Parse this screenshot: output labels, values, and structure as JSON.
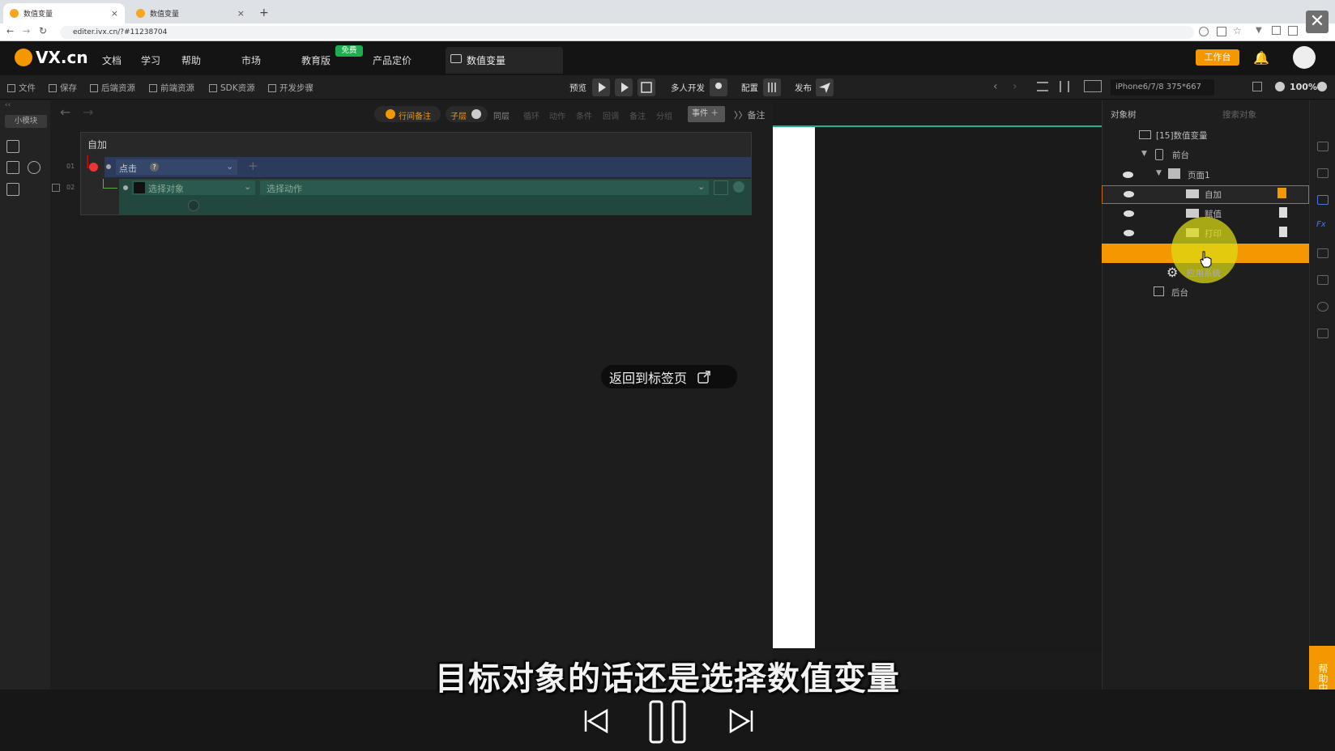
{
  "browser": {
    "tabs": [
      {
        "label": "数值变量",
        "active": true
      },
      {
        "label": "数值变量",
        "active": false
      }
    ],
    "url": "editer.ivx.cn/?#11238704"
  },
  "app": {
    "logo": "VX.cn",
    "menu": [
      "文档",
      "学习",
      "帮助",
      "市场",
      "教育版",
      "产品定价"
    ],
    "free_badge": "免费",
    "doc_tab": "数值变量",
    "workbench_button": "工作台"
  },
  "toolbar": {
    "left": [
      "文件",
      "保存",
      "后端资源",
      "前端资源",
      "SDK资源",
      "开发步骤"
    ],
    "preview": "预览",
    "multi_dev": "多人开发",
    "config": "配置",
    "publish": "发布",
    "device": "iPhone6/7/8 375*667",
    "zoom": "100%"
  },
  "rail": {
    "badge": "小模块"
  },
  "editor": {
    "filters": [
      "行间备注",
      "子层",
      "同层",
      "循环",
      "动作",
      "条件",
      "回调",
      "备注",
      "分组"
    ],
    "event_button": "事件",
    "notes_button": "备注",
    "panel_title": "自加",
    "row1": {
      "num": "01",
      "event": "点击"
    },
    "row2": {
      "num": "02",
      "target_placeholder": "选择对象",
      "action_placeholder": "选择动作"
    }
  },
  "tree": {
    "tab": "对象树",
    "search_placeholder": "搜索对象",
    "items": [
      {
        "label": "[15]数值变量"
      },
      {
        "label": "前台"
      },
      {
        "label": "页面1"
      },
      {
        "label": "自加"
      },
      {
        "label": "赋值"
      },
      {
        "label": "打印"
      },
      {
        "label": "应用系统"
      },
      {
        "label": "后台"
      }
    ]
  },
  "overlay": {
    "toast": "返回到标签页",
    "subtitle": "目标对象的话还是选择数值变量",
    "help_tab": "帮助中心"
  },
  "colors": {
    "accent": "#f39800",
    "row_event": "#2c3b5c",
    "row_action": "#21473e"
  }
}
